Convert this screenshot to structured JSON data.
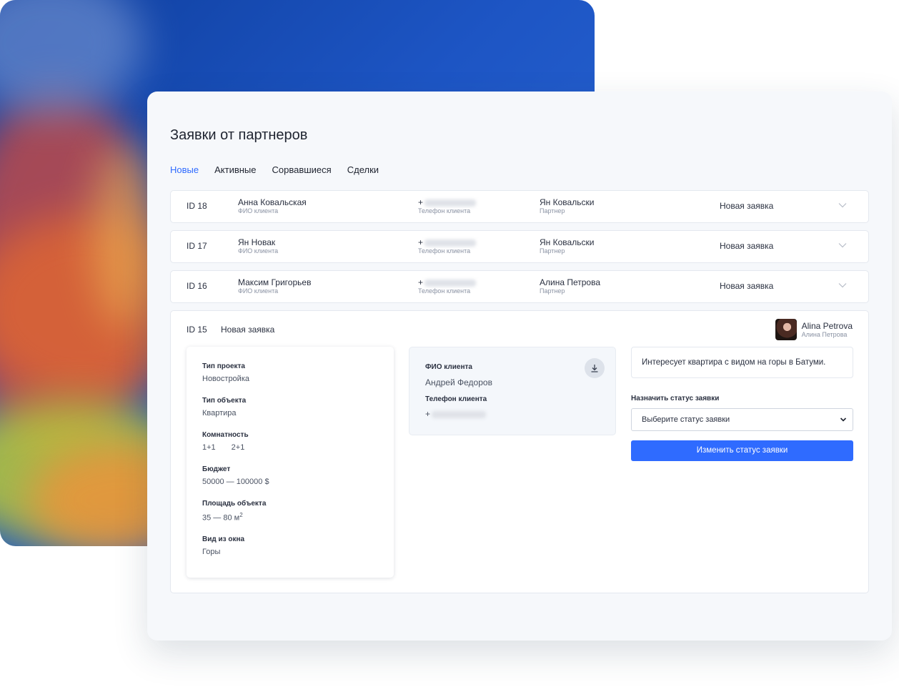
{
  "page": {
    "title": "Заявки от партнеров",
    "tabs": [
      {
        "label": "Новые",
        "active": true
      },
      {
        "label": "Активные",
        "active": false
      },
      {
        "label": "Сорвавшиеся",
        "active": false
      },
      {
        "label": "Сделки",
        "active": false
      }
    ]
  },
  "labels": {
    "client_name": "ФИО клиента",
    "client_phone": "Телефон клиента",
    "partner": "Партнер"
  },
  "requests": [
    {
      "id": "ID 18",
      "client": "Анна Ковальская",
      "phone_prefix": "+",
      "partner": "Ян Ковальски",
      "status": "Новая заявка"
    },
    {
      "id": "ID 17",
      "client": "Ян Новак",
      "phone_prefix": "+",
      "partner": "Ян Ковальски",
      "status": "Новая заявка"
    },
    {
      "id": "ID 16",
      "client": "Максим Григорьев",
      "phone_prefix": "+",
      "partner": "Алина Петрова",
      "status": "Новая заявка"
    }
  ],
  "detail": {
    "id": "ID 15",
    "status": "Новая заявка",
    "partner_name": "Alina Petrova",
    "partner_sub": "Алина Петрова",
    "specs": [
      {
        "key": "Тип проекта",
        "value": "Новостройка"
      },
      {
        "key": "Тип объекта",
        "value": "Квартира"
      },
      {
        "key": "Комнатность",
        "values": [
          "1+1",
          "2+1"
        ]
      },
      {
        "key": "Бюджет",
        "value": "50000 — 100000 $"
      },
      {
        "key": "Площадь объекта",
        "value": "35 — 80 м",
        "sup": "2"
      },
      {
        "key": "Вид из окна",
        "value": "Горы"
      }
    ],
    "client_block": {
      "name_label": "ФИО клиента",
      "name": "Андрей Федоров",
      "phone_label": "Телефон клиента",
      "phone_prefix": "+"
    },
    "note": "Интересует квартира с видом на горы в Батуми.",
    "assign_label": "Назначить статус заявки",
    "select_value": "Выберите статус заявки",
    "submit_label": "Изменить статус заявки"
  },
  "colors": {
    "accent": "#2f6bff",
    "card_bg": "#f6f8fb",
    "backdrop": "#1d55c4"
  },
  "icons": [
    "chevron-down-icon",
    "download-icon",
    "select-arrow-icon"
  ]
}
